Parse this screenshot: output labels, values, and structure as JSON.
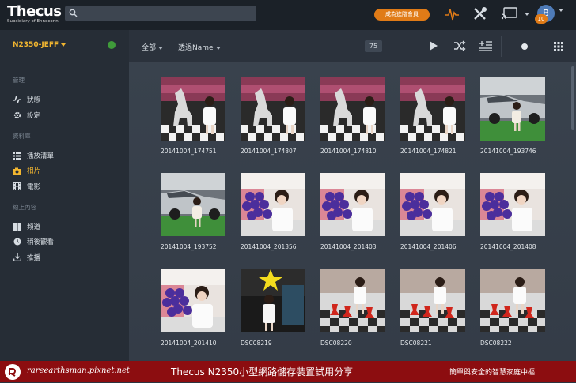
{
  "header": {
    "logo_text": "Thecus",
    "logo_sub": "Subsidiary of Ennoconn",
    "search_placeholder": "",
    "vip_button": "成為進階會員",
    "notification_count": "10",
    "user_initial": "B"
  },
  "sidebar": {
    "server_name": "N2350-JEFF",
    "sections": [
      {
        "label": "管理",
        "items": [
          {
            "label": "狀態",
            "icon": "activity-icon"
          },
          {
            "label": "設定",
            "icon": "gear-icon"
          }
        ]
      },
      {
        "label": "資料庫",
        "items": [
          {
            "label": "播放清單",
            "icon": "list-icon"
          },
          {
            "label": "相片",
            "icon": "camera-icon",
            "active": true
          },
          {
            "label": "電影",
            "icon": "film-icon"
          }
        ]
      },
      {
        "label": "線上內容",
        "items": [
          {
            "label": "頻道",
            "icon": "grid-icon"
          },
          {
            "label": "稍後觀看",
            "icon": "clock-icon"
          },
          {
            "label": "推播",
            "icon": "download-icon"
          }
        ]
      }
    ]
  },
  "toolbar": {
    "filter_label": "全部",
    "sort_label": "透過Name",
    "count": "75"
  },
  "photos": [
    {
      "label": "20141004_174751",
      "scene": "unicorn"
    },
    {
      "label": "20141004_174807",
      "scene": "unicorn"
    },
    {
      "label": "20141004_174810",
      "scene": "unicorn"
    },
    {
      "label": "20141004_174821",
      "scene": "unicorn"
    },
    {
      "label": "20141004_193746",
      "scene": "car"
    },
    {
      "label": "20141004_193752",
      "scene": "car"
    },
    {
      "label": "20141004_201356",
      "scene": "grapes"
    },
    {
      "label": "20141004_201403",
      "scene": "grapes"
    },
    {
      "label": "20141004_201406",
      "scene": "grapes"
    },
    {
      "label": "20141004_201408",
      "scene": "grapes"
    },
    {
      "label": "20141004_201410",
      "scene": "grapes"
    },
    {
      "label": "DSC08219",
      "scene": "star"
    },
    {
      "label": "DSC08220",
      "scene": "chess"
    },
    {
      "label": "DSC08221",
      "scene": "chess"
    },
    {
      "label": "DSC08222",
      "scene": "chess"
    }
  ],
  "footer": {
    "site": "rareearthsman.pixnet.net",
    "title": "Thecus N2350小型網路儲存裝置試用分享",
    "slogan": "簡單與安全的智慧家庭中樞"
  },
  "colors": {
    "accent": "#f2b630",
    "vip": "#e07b17",
    "footer": "#8c0d10"
  }
}
